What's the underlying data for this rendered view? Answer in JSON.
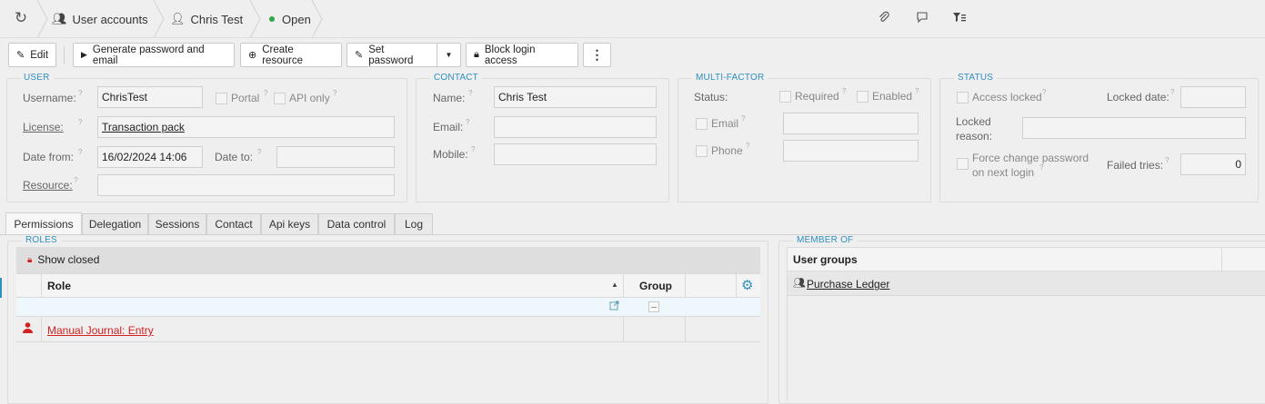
{
  "breadcrumb": {
    "items": [
      {
        "label": "User accounts",
        "icon": "user-group-icon"
      },
      {
        "label": "Chris Test",
        "icon": "user-icon"
      },
      {
        "label": "Open",
        "status_color": "#2fa84f"
      }
    ],
    "right_icons": [
      "paperclip-icon",
      "comment-icon",
      "filter-list-icon"
    ]
  },
  "toolbar": {
    "edit": "Edit",
    "generate": "Generate password and email",
    "create_resource": "Create resource",
    "set_password": "Set password",
    "block_login": "Block login access"
  },
  "user": {
    "legend": "USER",
    "username_label": "Username:",
    "username": "ChrisTest",
    "portal_label": "Portal",
    "api_only_label": "API only",
    "license_label": "License:",
    "license": "Transaction pack",
    "date_from_label": "Date from:",
    "date_from": "16/02/2024 14:06",
    "date_to_label": "Date to:",
    "date_to": "",
    "resource_label": "Resource:",
    "resource": ""
  },
  "contact": {
    "legend": "CONTACT",
    "name_label": "Name:",
    "name": "Chris Test",
    "email_label": "Email:",
    "email": "",
    "mobile_label": "Mobile:",
    "mobile": ""
  },
  "mfa": {
    "legend": "MULTI-FACTOR",
    "status_label": "Status:",
    "required_label": "Required",
    "enabled_label": "Enabled",
    "email_label": "Email",
    "phone_label": "Phone"
  },
  "status": {
    "legend": "STATUS",
    "access_locked_label": "Access locked",
    "locked_date_label": "Locked date:",
    "locked_reason_label_1": "Locked",
    "locked_reason_label_2": "reason:",
    "force_change_1": "Force change password",
    "force_change_2": "on next login",
    "failed_tries_label": "Failed tries:",
    "failed_tries": "0"
  },
  "tabs": [
    "Permissions",
    "Delegation",
    "Sessions",
    "Contact",
    "Api keys",
    "Data control",
    "Log"
  ],
  "roles": {
    "legend": "ROLES",
    "show_closed": "Show closed",
    "col_role": "Role",
    "col_group": "Group",
    "rows": [
      {
        "role": "Manual Journal: Entry"
      }
    ]
  },
  "member_of": {
    "legend": "MEMBER OF",
    "col_user_groups": "User groups",
    "rows": [
      {
        "group": "Purchase Ledger"
      }
    ]
  },
  "colors": {
    "accent": "#2f8fbf",
    "status_open": "#2fa84f",
    "role_red": "#d32020"
  }
}
